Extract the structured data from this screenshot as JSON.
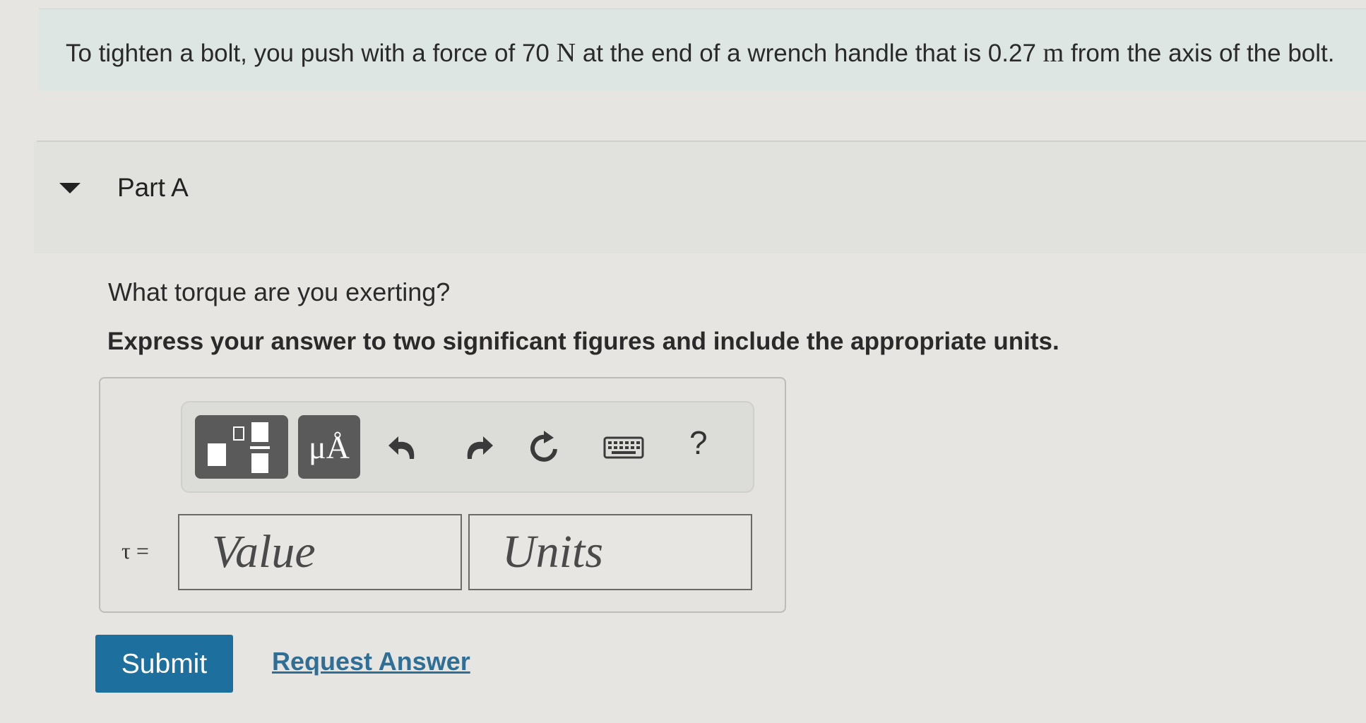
{
  "problem": {
    "text_1": "To tighten a bolt, you push with a force of 70",
    "unit_force": "N",
    "text_2": "at the end of a wrench handle that is 0.27",
    "unit_length": "m",
    "text_3": "from the axis of the bolt."
  },
  "part": {
    "title": "Part A",
    "question": "What torque are you exerting?",
    "instruction": "Express your answer to two significant figures and include the appropriate units."
  },
  "toolbar": {
    "units_label": "μÅ",
    "help_label": "?"
  },
  "answer": {
    "variable_label": "τ =",
    "value_placeholder": "Value",
    "units_placeholder": "Units"
  },
  "actions": {
    "submit_label": "Submit",
    "request_label": "Request Answer"
  },
  "colors": {
    "submit_bg": "#1d6f9e",
    "link": "#2f6f95",
    "problem_bg": "#dde6e2"
  }
}
